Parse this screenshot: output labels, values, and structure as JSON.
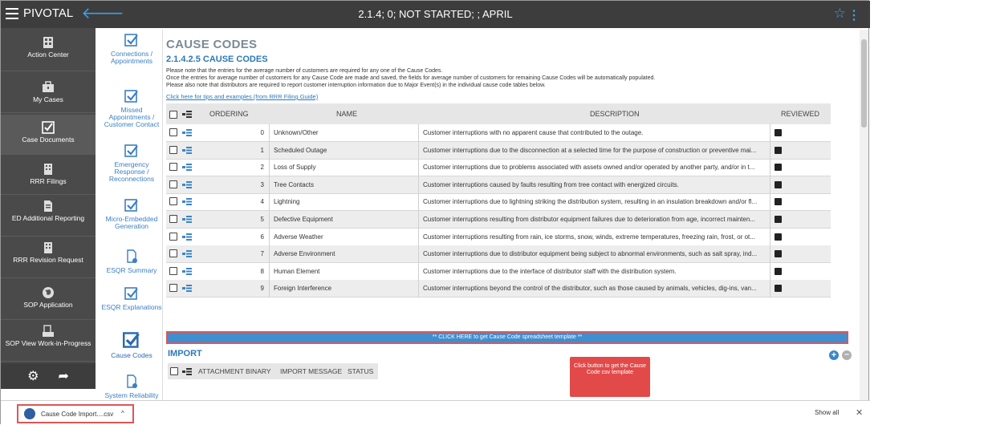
{
  "app": {
    "brand": "PIVOTAL",
    "title": "2.1.4; 0; NOT STARTED; ; APRIL"
  },
  "rail": [
    {
      "label": "Action Center",
      "icon": "building-icon"
    },
    {
      "label": "My Cases",
      "icon": "briefcase-icon"
    },
    {
      "label": "Case Documents",
      "icon": "checkbox-icon"
    },
    {
      "label": "RRR Filings",
      "icon": "building-icon"
    },
    {
      "label": "ED Additional Reporting",
      "icon": "document-icon"
    },
    {
      "label": "RRR Revision Request",
      "icon": "building-icon"
    },
    {
      "label": "SOP Application",
      "icon": "globe-icon"
    },
    {
      "label": "SOP View Work-in-Progress",
      "icon": "folder-icon"
    }
  ],
  "subnav": [
    {
      "label": "Connections / Appointments",
      "icon": "checkbox-icon"
    },
    {
      "label": "Missed Appointments / Customer Contact",
      "icon": "checkbox-icon"
    },
    {
      "label": "Emergency Response / Reconnections",
      "icon": "checkbox-icon"
    },
    {
      "label": "Micro-Embedded Generation",
      "icon": "checkbox-icon"
    },
    {
      "label": "ESQR Summary",
      "icon": "doc-gear-icon"
    },
    {
      "label": "ESQR Explanations",
      "icon": "checkbox-icon"
    },
    {
      "label": "Cause Codes",
      "icon": "checkbox-icon"
    },
    {
      "label": "System Reliability",
      "icon": "doc-gear-icon"
    }
  ],
  "main": {
    "page_title": "CAUSE CODES",
    "section_title": "2.1.4.2.5 CAUSE CODES",
    "notes": [
      "Please note that the entries for the average number of customers are required for any one of the Cause Codes.",
      "Once the entries for average number of customers for any Cause Code are made and saved, the fields for average number of customers for remaining Cause Codes will be automatically populated.",
      "Please also note that distributors are required to report customer interruption information due to Major Event(s) in the individual cause code tables below."
    ],
    "tips_link": "Click here for tips and examples (from RRR Filing Guide)",
    "columns": {
      "ordering": "ORDERING",
      "name": "NAME",
      "description": "DESCRIPTION",
      "reviewed": "REVIEWED"
    },
    "rows": [
      {
        "ordering": "0",
        "name": "Unknown/Other",
        "description": "Customer interruptions with no apparent cause that contributed to the outage."
      },
      {
        "ordering": "1",
        "name": "Scheduled Outage",
        "description": "Customer interruptions due to the disconnection at a selected time for the purpose of construction or preventive mai..."
      },
      {
        "ordering": "2",
        "name": "Loss of Supply",
        "description": "Customer interruptions due to problems associated with assets owned and/or operated by another party, and/or in t..."
      },
      {
        "ordering": "3",
        "name": "Tree Contacts",
        "description": "Customer interruptions caused by faults resulting from tree contact with energized circuits."
      },
      {
        "ordering": "4",
        "name": "Lightning",
        "description": "Customer interruptions due to lightning striking the distribution system, resulting in an insulation breakdown and/or fl..."
      },
      {
        "ordering": "5",
        "name": "Defective Equipment",
        "description": "Customer interruptions resulting from distributor equipment failures due to deterioration from age, incorrect mainten..."
      },
      {
        "ordering": "6",
        "name": "Adverse Weather",
        "description": "Customer interruptions resulting from rain, ice storms, snow, winds, extreme temperatures, freezing rain, frost, or ot..."
      },
      {
        "ordering": "7",
        "name": "Adverse Environment",
        "description": "Customer interruptions due to distributor equipment being subject to abnormal environments, such as salt spray, ind..."
      },
      {
        "ordering": "8",
        "name": "Human Element",
        "description": "Customer interruptions due to the interface of distributor staff with the distribution system."
      },
      {
        "ordering": "9",
        "name": "Foreign Interference",
        "description": "Customer interruptions beyond the control of the distributor, such as those caused by animals, vehicles, dig-ins, van..."
      }
    ],
    "template_button": "** CLICK HERE to get Cause Code spreadsheet template **",
    "import_title": "IMPORT",
    "import_columns": {
      "attachment": "ATTACHMENT BINARY",
      "message": "IMPORT MESSAGE",
      "status": "STATUS"
    },
    "callout": "Click button to get the Cause Code csv template"
  },
  "download": {
    "file": "Cause Code Import....csv",
    "show_all": "Show all",
    "close": "✕",
    "chevron": "^"
  },
  "colors": {
    "accent": "#3a86c8",
    "callout": "#e24a4a",
    "topbar": "#3d3d3d",
    "rail": "#4a4a4a"
  }
}
